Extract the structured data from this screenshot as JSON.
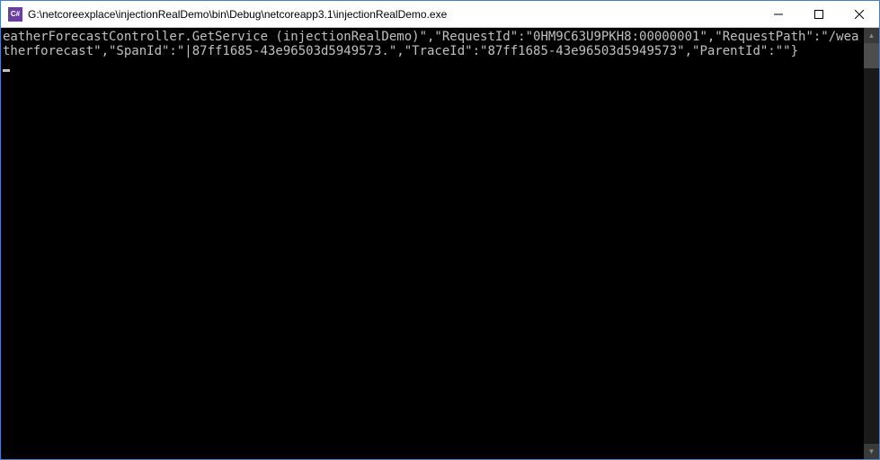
{
  "titlebar": {
    "icon_label": "C#",
    "title": "G:\\netcoreexplace\\injectionRealDemo\\bin\\Debug\\netcoreapp3.1\\injectionRealDemo.exe"
  },
  "window_controls": {
    "minimize": "minimize",
    "maximize": "maximize",
    "close": "close"
  },
  "console": {
    "output": "eatherForecastController.GetService (injectionRealDemo)\",\"RequestId\":\"0HM9C63U9PKH8:00000001\",\"RequestPath\":\"/weatherforecast\",\"SpanId\":\"|87ff1685-43e96503d5949573.\",\"TraceId\":\"87ff1685-43e96503d5949573\",\"ParentId\":\"\"}"
  },
  "scrollbar": {
    "up": "▲",
    "down": "▼"
  }
}
